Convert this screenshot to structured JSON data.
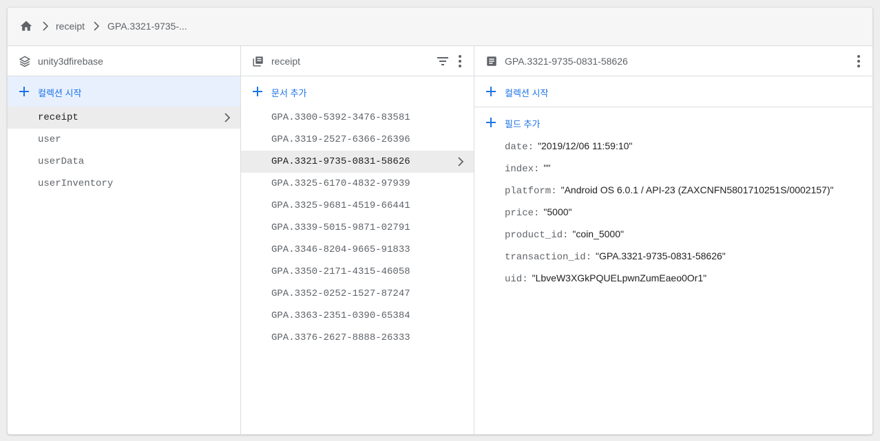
{
  "breadcrumb": {
    "items": [
      "receipt",
      "GPA.3321-9735-..."
    ]
  },
  "columns": {
    "root": {
      "title": "unity3dfirebase",
      "action_label": "컬렉션 시작",
      "collections": [
        "receipt",
        "user",
        "userData",
        "userInventory"
      ],
      "selected_index": 0
    },
    "collection": {
      "title": "receipt",
      "action_label": "문서 추가",
      "documents": [
        "GPA.3300-5392-3476-83581",
        "GPA.3319-2527-6366-26396",
        "GPA.3321-9735-0831-58626",
        "GPA.3325-6170-4832-97939",
        "GPA.3325-9681-4519-66441",
        "GPA.3339-5015-9871-02791",
        "GPA.3346-8204-9665-91833",
        "GPA.3350-2171-4315-46058",
        "GPA.3352-0252-1527-87247",
        "GPA.3363-2351-0390-65384",
        "GPA.3376-2627-8888-26333"
      ],
      "selected_index": 2
    },
    "document": {
      "title": "GPA.3321-9735-0831-58626",
      "start_collection_label": "컬렉션 시작",
      "add_field_label": "필드 추가",
      "fields": [
        {
          "key": "date:",
          "value": "\"2019/12/06 11:59:10\""
        },
        {
          "key": "index:",
          "value": "\"\""
        },
        {
          "key": "platform:",
          "value": "\"Android OS 6.0.1 / API-23 (ZAXCNFN5801710251S/0002157)\""
        },
        {
          "key": "price:",
          "value": "\"5000\""
        },
        {
          "key": "product_id:",
          "value": "\"coin_5000\""
        },
        {
          "key": "transaction_id:",
          "value": "\"GPA.3321-9735-0831-58626\""
        },
        {
          "key": "uid:",
          "value": "\"LbveW3XGkPQUELpwnZumEaeo0Or1\""
        }
      ]
    }
  },
  "colors": {
    "accent": "#1a73e8",
    "selected_action_bg": "#e8f0fe",
    "selected_row_bg": "#ececec"
  }
}
